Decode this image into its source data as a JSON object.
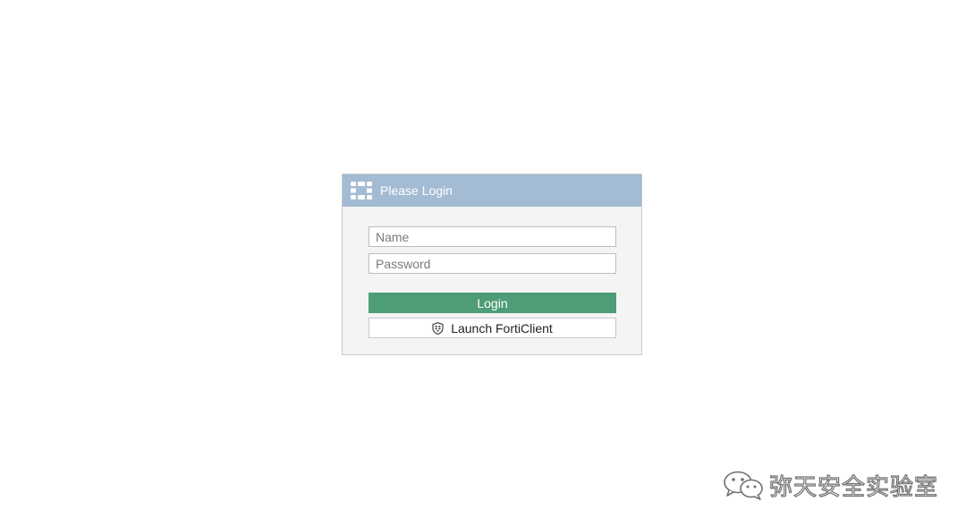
{
  "login": {
    "header": {
      "title": "Please Login",
      "logo_icon": "fortinet-logo-icon",
      "background_color": "#a3bbd3"
    },
    "name_field": {
      "placeholder": "Name",
      "value": ""
    },
    "password_field": {
      "placeholder": "Password",
      "value": ""
    },
    "login_button": {
      "label": "Login",
      "color": "#4e9d76"
    },
    "forticlient_button": {
      "label": "Launch FortiClient",
      "icon": "forticlient-shield-icon"
    }
  },
  "watermark": {
    "text": "弥天安全实验室",
    "icon": "wechat-icon"
  }
}
